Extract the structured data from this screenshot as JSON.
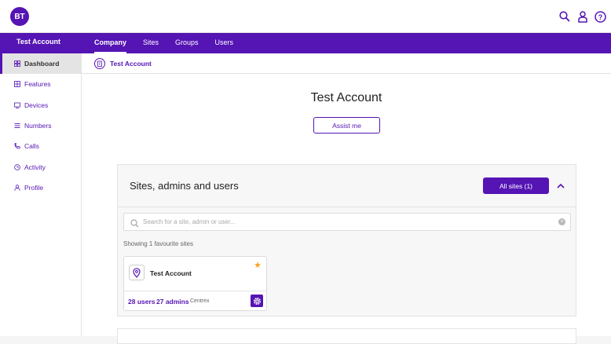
{
  "brand": {
    "logo_text": "BT",
    "accent": "#5514b4"
  },
  "topbar": {
    "icons": [
      "search-icon",
      "user-icon",
      "help-icon"
    ]
  },
  "nav": {
    "account": "Test Account",
    "tabs": [
      {
        "label": "Company",
        "active": true
      },
      {
        "label": "Sites",
        "active": false
      },
      {
        "label": "Groups",
        "active": false
      },
      {
        "label": "Users",
        "active": false
      }
    ]
  },
  "sidebar": {
    "items": [
      {
        "label": "Dashboard",
        "icon": "dashboard-icon",
        "active": true
      },
      {
        "label": "Features",
        "icon": "features-icon",
        "active": false
      },
      {
        "label": "Devices",
        "icon": "devices-icon",
        "active": false
      },
      {
        "label": "Numbers",
        "icon": "numbers-icon",
        "active": false
      },
      {
        "label": "Calls",
        "icon": "calls-icon",
        "active": false
      },
      {
        "label": "Activity",
        "icon": "activity-icon",
        "active": false
      },
      {
        "label": "Profile",
        "icon": "profile-icon",
        "active": false
      }
    ]
  },
  "breadcrumb": {
    "label": "Test Account",
    "icon": "building-icon"
  },
  "main": {
    "title": "Test Account",
    "assist_label": "Assist me",
    "panel": {
      "title": "Sites, admins and users",
      "all_sites_label": "All sites (1)",
      "search_placeholder": "Search for a site, admin or user...",
      "showing_text": "Showing 1 favourite sites",
      "card": {
        "title": "Test Account",
        "users": "28 users",
        "admins": "27 admins",
        "type": "Centrex",
        "favourite_color": "#f5a623"
      }
    }
  }
}
